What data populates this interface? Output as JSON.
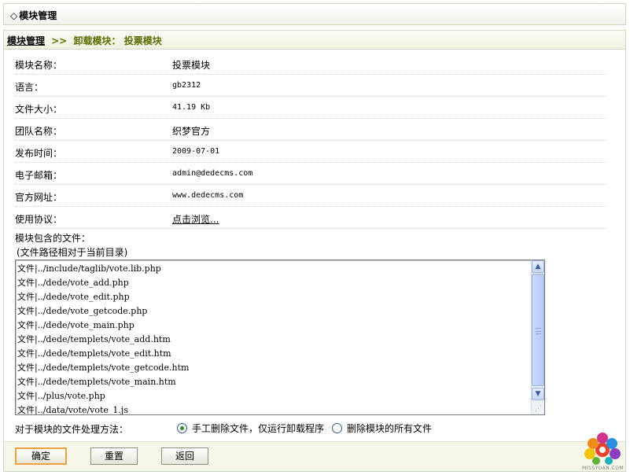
{
  "header": {
    "diamond": "◇",
    "title": "模块管理"
  },
  "breadcrumb": {
    "home": "模块管理",
    "separator": ">>",
    "step1": "卸载模块：",
    "step2": "投票模块"
  },
  "info": [
    {
      "label": "模块名称：",
      "value": "投票模块"
    },
    {
      "label": "语言：",
      "value": "gb2312"
    },
    {
      "label": "文件大小：",
      "value": "41.19 Kb"
    },
    {
      "label": "团队名称：",
      "value": "织梦官方"
    },
    {
      "label": "发布时间：",
      "value": "2009-07-01"
    },
    {
      "label": "电子邮箱：",
      "value": "admin@dedecms.com"
    },
    {
      "label": "官方网址：",
      "value": "www.dedecms.com"
    },
    {
      "label": "使用协议：",
      "value": "点击浏览..."
    }
  ],
  "files": {
    "label": "模块包含的文件：",
    "note": "(文件路径相对于当前目录)",
    "items": [
      "文件|../include/taglib/vote.lib.php",
      "文件|../dede/vote_add.php",
      "文件|../dede/vote_edit.php",
      "文件|../dede/vote_getcode.php",
      "文件|../dede/vote_main.php",
      "文件|../dede/templets/vote_add.htm",
      "文件|../dede/templets/vote_edit.htm",
      "文件|../dede/templets/vote_getcode.htm",
      "文件|../dede/templets/vote_main.htm",
      "文件|../plus/vote.php",
      "文件|../data/vote/vote_1.js"
    ]
  },
  "method": {
    "label": "对于模块的文件处理方法：",
    "options": [
      "手工删除文件，仅运行卸载程序",
      "删除模块的所有文件"
    ],
    "selected": 0
  },
  "buttons": {
    "ok": "确定",
    "reset": "重置",
    "back": "返回"
  },
  "logo": {
    "text": "MISSYUAN.COM"
  },
  "icons": {
    "scroll_up": "chevron-up-icon",
    "scroll_down": "chevron-down-icon",
    "resize": "resize-grip-icon",
    "logo": "peacock-logo"
  }
}
